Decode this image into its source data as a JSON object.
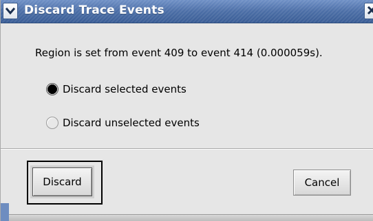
{
  "window": {
    "title": "Discard Trace Events"
  },
  "message": "Region is set from event 409 to event 414 (0.000059s).",
  "options": [
    {
      "label": "Discard selected events",
      "selected": true
    },
    {
      "label": "Discard unselected events",
      "selected": false
    }
  ],
  "buttons": {
    "discard": "Discard",
    "cancel": "Cancel"
  },
  "icons": {
    "window_menu": "chevron-down-icon",
    "close": "close-icon"
  },
  "colors": {
    "titlebar": "#4b6ea6",
    "title_text": "#ffffff",
    "background": "#e6e6e6"
  }
}
